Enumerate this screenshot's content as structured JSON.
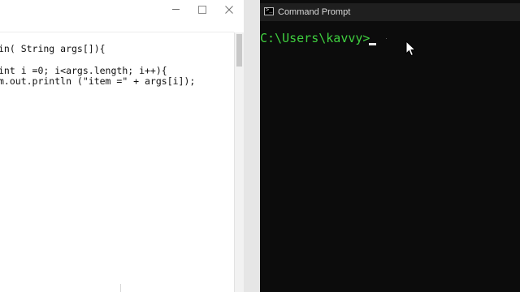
{
  "editor": {
    "code_lines": [
      "in( String args[]){",
      "int i =0; i<args.length; i++){",
      "m.out.println (\"item =\" + args[i]);"
    ]
  },
  "cmd": {
    "title": "Command Prompt",
    "prompt": "C:\\Users\\kavvy>",
    "icon": "cmd-icon",
    "text_color": "#3fcf3f"
  },
  "pointer": {
    "icon": "mouse-pointer-icon"
  }
}
